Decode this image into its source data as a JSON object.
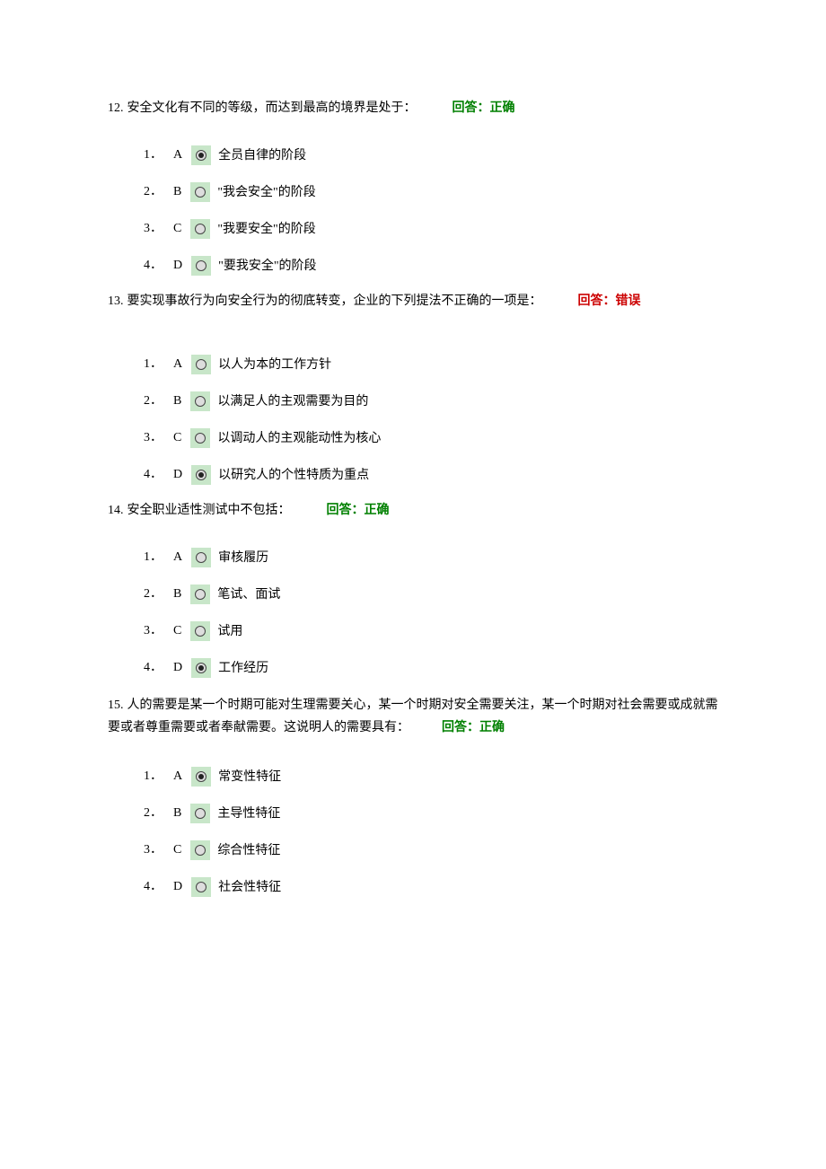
{
  "labels": {
    "feedback_prefix": "回答：",
    "correct": "正确",
    "wrong": "错误"
  },
  "questions": [
    {
      "number": "12.",
      "text": "安全文化有不同的等级，而达到最高的境界是处于：",
      "feedback": "correct",
      "multiline": false,
      "options": [
        {
          "idx": "1．",
          "letter": "A",
          "selected": true,
          "text": "全员自律的阶段"
        },
        {
          "idx": "2．",
          "letter": "B",
          "selected": false,
          "text": "\"我会安全\"的阶段"
        },
        {
          "idx": "3．",
          "letter": "C",
          "selected": false,
          "text": "\"我要安全\"的阶段"
        },
        {
          "idx": "4．",
          "letter": "D",
          "selected": false,
          "text": "\"要我安全\"的阶段"
        }
      ]
    },
    {
      "number": "13.",
      "text": "要实现事故行为向安全行为的彻底转变，企业的下列提法不正确的一项是：",
      "feedback": "wrong",
      "multiline": false,
      "big_gap": true,
      "options": [
        {
          "idx": "1．",
          "letter": "A",
          "selected": false,
          "text": "以人为本的工作方针"
        },
        {
          "idx": "2．",
          "letter": "B",
          "selected": false,
          "text": "以满足人的主观需要为目的"
        },
        {
          "idx": "3．",
          "letter": "C",
          "selected": false,
          "text": "以调动人的主观能动性为核心"
        },
        {
          "idx": "4．",
          "letter": "D",
          "selected": true,
          "text": "以研究人的个性特质为重点"
        }
      ]
    },
    {
      "number": "14.",
      "text": "安全职业适性测试中不包括：",
      "feedback": "correct",
      "multiline": false,
      "options": [
        {
          "idx": "1．",
          "letter": "A",
          "selected": false,
          "text": "审核履历"
        },
        {
          "idx": "2．",
          "letter": "B",
          "selected": false,
          "text": "笔试、面试"
        },
        {
          "idx": "3．",
          "letter": "C",
          "selected": false,
          "text": "试用"
        },
        {
          "idx": "4．",
          "letter": "D",
          "selected": true,
          "text": "工作经历"
        }
      ]
    },
    {
      "number": "15.",
      "text": "人的需要是某一个时期可能对生理需要关心，某一个时期对安全需要关注，某一个时期对社会需要或成就需要或者尊重需要或者奉献需要。这说明人的需要具有：",
      "feedback": "correct",
      "multiline": true,
      "options": [
        {
          "idx": "1．",
          "letter": "A",
          "selected": true,
          "text": "常变性特征"
        },
        {
          "idx": "2．",
          "letter": "B",
          "selected": false,
          "text": "主导性特征"
        },
        {
          "idx": "3．",
          "letter": "C",
          "selected": false,
          "text": "综合性特征"
        },
        {
          "idx": "4．",
          "letter": "D",
          "selected": false,
          "text": "社会性特征"
        }
      ]
    }
  ]
}
